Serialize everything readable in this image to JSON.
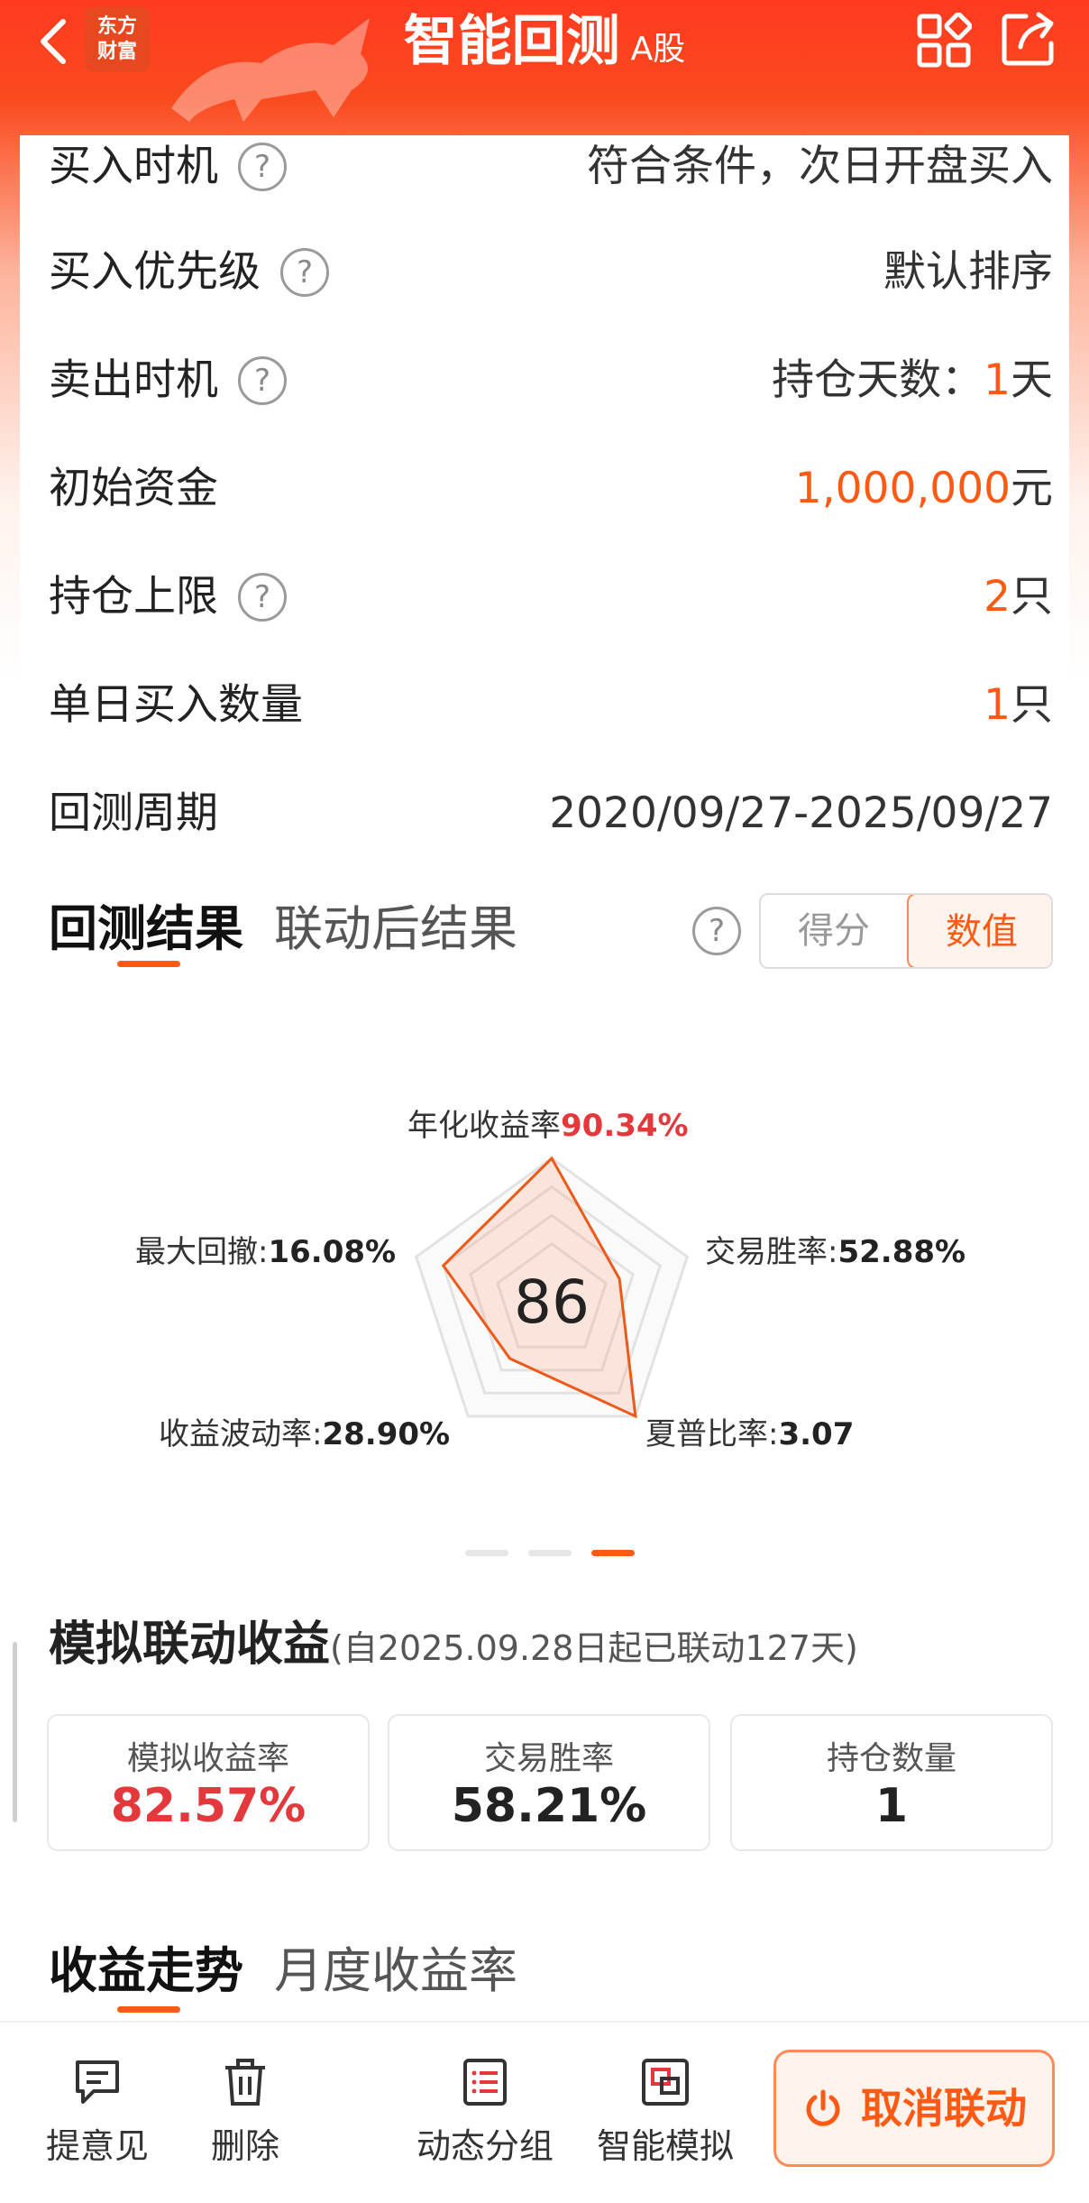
{
  "header": {
    "title": "智能回测",
    "subtitle": "A股",
    "logo_line1": "东方",
    "logo_line2": "财富"
  },
  "settings": [
    {
      "label": "买入时机",
      "help": true,
      "value_plain": "符合条件，次日开盘买入",
      "value_accent": "",
      "value_suffix": ""
    },
    {
      "label": "买入优先级",
      "help": true,
      "value_plain": "默认排序",
      "value_accent": "",
      "value_suffix": ""
    },
    {
      "label": "卖出时机",
      "help": true,
      "value_plain": "持仓天数：",
      "value_accent": "1",
      "value_suffix": "天"
    },
    {
      "label": "初始资金",
      "help": false,
      "value_plain": "",
      "value_accent": "1,000,000",
      "value_suffix": "元"
    },
    {
      "label": "持仓上限",
      "help": true,
      "value_plain": "",
      "value_accent": "2",
      "value_suffix": "只"
    },
    {
      "label": "单日买入数量",
      "help": false,
      "value_plain": "",
      "value_accent": "1",
      "value_suffix": "只"
    },
    {
      "label": "回测周期",
      "help": false,
      "value_plain": "2020/09/27-2025/09/27",
      "value_accent": "",
      "value_suffix": ""
    }
  ],
  "result_tabs": {
    "active": "回测结果",
    "inactive": "联动后结果"
  },
  "toggle": {
    "option1": "得分",
    "option2": "数值",
    "selected": "数值"
  },
  "radar": {
    "score": "86",
    "metrics": [
      {
        "name": "年化收益率",
        "value": "90.34%",
        "highlight": true,
        "level": 1.0
      },
      {
        "name": "交易胜率",
        "value": "52.88%",
        "highlight": false,
        "level": 0.5
      },
      {
        "name": "夏普比率",
        "value": "3.07",
        "highlight": false,
        "level": 1.0
      },
      {
        "name": "收益波动率",
        "value": "28.90%",
        "highlight": false,
        "level": 0.5
      },
      {
        "name": "最大回撤",
        "value": "16.08%",
        "highlight": false,
        "level": 0.8
      }
    ],
    "page_index": 3,
    "page_count": 3
  },
  "simulation": {
    "title": "模拟联动收益",
    "note": "(自2025.09.28日起已联动127天)",
    "stats": [
      {
        "label": "模拟收益率",
        "value": "82.57%",
        "highlight": true
      },
      {
        "label": "交易胜率",
        "value": "58.21%",
        "highlight": false
      },
      {
        "label": "持仓数量",
        "value": "1",
        "highlight": false
      }
    ]
  },
  "trend_tabs": {
    "active": "收益走势",
    "inactive": "月度收益率"
  },
  "bottom_bar": {
    "feedback": "提意见",
    "delete": "删除",
    "dynamic_group": "动态分组",
    "smart_sim": "智能模拟",
    "cancel_link": "取消联动"
  },
  "colors": {
    "accent": "#ff5a14",
    "header": "#ff3a20",
    "red": "#e4393c"
  }
}
